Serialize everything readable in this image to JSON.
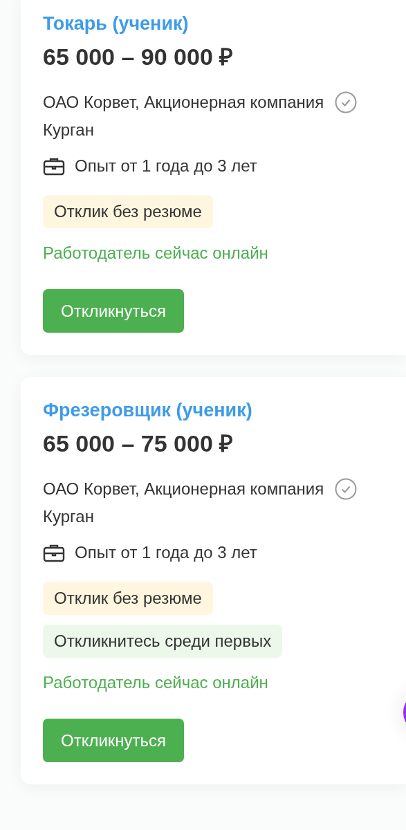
{
  "vacancies": [
    {
      "title": "Токарь (ученик)",
      "salary": "65 000 – 90 000 ₽",
      "company": "ОАО Корвет, Акционерная компания",
      "verified": true,
      "city": "Курган",
      "experience": "Опыт от 1 года до 3 лет",
      "tags": [
        {
          "label": "Отклик без резюме",
          "color": "#fff6e0"
        }
      ],
      "online": "Работодатель сейчас онлайн",
      "button": "Откликнуться"
    },
    {
      "title": "Фрезеровщик (ученик)",
      "salary": "65 000 – 75 000 ₽",
      "company": "ОАО Корвет, Акционерная компания",
      "verified": true,
      "city": "Курган",
      "experience": "Опыт от 1 года до 3 лет",
      "tags": [
        {
          "label": "Отклик без резюме",
          "color": "#fff6e0"
        },
        {
          "label": "Откликнитесь среди первых",
          "color": "#ebf8ea"
        }
      ],
      "online": "Работодатель сейчас онлайн",
      "button": "Откликнуться"
    }
  ]
}
